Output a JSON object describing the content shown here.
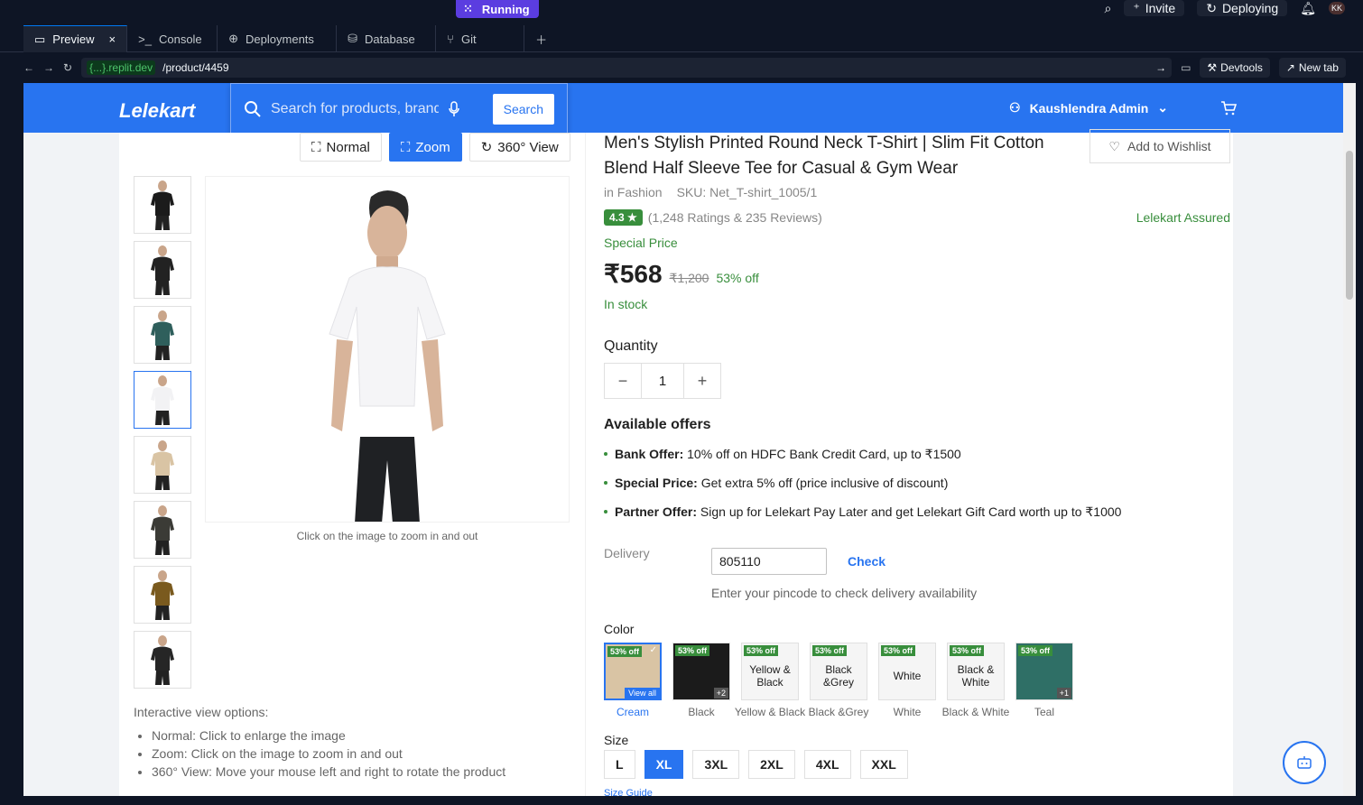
{
  "topbar": {
    "running": "Running",
    "invite": "Invite",
    "deploying": "Deploying",
    "avatar": "KK"
  },
  "tabs": [
    {
      "label": "Preview",
      "icon": "monitor-icon"
    },
    {
      "label": "Console",
      "icon": "terminal-icon"
    },
    {
      "label": "Deployments",
      "icon": "deploy-icon"
    },
    {
      "label": "Database",
      "icon": "database-icon"
    },
    {
      "label": "Git",
      "icon": "git-icon"
    }
  ],
  "browser": {
    "domain": "{...}.replit.dev",
    "path": "/product/4459",
    "devtools": "Devtools",
    "newtab": "New tab"
  },
  "header": {
    "logo": "Lelekart",
    "search_placeholder": "Search for products, brands",
    "search_button": "Search",
    "user": "Kaushlendra Admin"
  },
  "gallery": {
    "view_normal": "Normal",
    "view_zoom": "Zoom",
    "view_360": "360° View",
    "zoom_caption": "Click on the image to zoom in and out",
    "thumb_colors": [
      "#1b1b1b",
      "#222222",
      "#2f5f5c",
      "#f2f2f4",
      "#d9c4a4",
      "#3b3b36",
      "#7a5a1e",
      "#262626"
    ],
    "options_title": "Interactive view options:",
    "options": [
      "Normal: Click to enlarge the image",
      "Zoom: Click on the image to zoom in and out",
      "360° View: Move your mouse left and right to rotate the product"
    ]
  },
  "product": {
    "title": "Men's Stylish Printed Round Neck T-Shirt | Slim Fit Cotton Blend Half Sleeve Tee for Casual & Gym Wear",
    "wishlist": "Add to Wishlist",
    "category": "in Fashion",
    "sku": "SKU: Net_T-shirt_1005/1",
    "rating": "4.3 ★",
    "reviews": "(1,248 Ratings & 235 Reviews)",
    "assured": "Lelekart Assured",
    "special_price": "Special Price",
    "price": "₹568",
    "mrp": "₹1,200",
    "discount": "53% off",
    "stock": "In stock",
    "quantity_label": "Quantity",
    "quantity": "1",
    "offers_title": "Available offers",
    "offers": [
      {
        "title": "Bank Offer:",
        "text": "10% off on HDFC Bank Credit Card, up to ₹1500"
      },
      {
        "title": "Special Price:",
        "text": "Get extra 5% off (price inclusive of discount)"
      },
      {
        "title": "Partner Offer:",
        "text": "Sign up for Lelekart Pay Later and get Lelekart Gift Card worth up to ₹1000"
      }
    ],
    "delivery_label": "Delivery",
    "pincode": "805110",
    "check": "Check",
    "pin_hint": "Enter your pincode to check delivery availability",
    "color_label": "Color",
    "colors": [
      {
        "name": "Cream",
        "badge": "53% off",
        "thumb": "",
        "extra": "View all",
        "bg": "#d9c4a4"
      },
      {
        "name": "Black",
        "badge": "53% off",
        "thumb": "",
        "extra": "+2",
        "bg": "#1b1b1b"
      },
      {
        "name": "Yellow & Black",
        "badge": "53% off",
        "thumb": "Yellow & Black",
        "extra": "",
        "bg": ""
      },
      {
        "name": "Black &Grey",
        "badge": "53% off",
        "thumb": "Black &Grey",
        "extra": "",
        "bg": ""
      },
      {
        "name": "White",
        "badge": "53% off",
        "thumb": "White",
        "extra": "",
        "bg": ""
      },
      {
        "name": "Black & White",
        "badge": "53% off",
        "thumb": "Black & White",
        "extra": "",
        "bg": ""
      },
      {
        "name": "Teal",
        "badge": "53% off",
        "thumb": "",
        "extra": "+1",
        "bg": "#2f6f66"
      }
    ],
    "size_label": "Size",
    "sizes": [
      "L",
      "XL",
      "3XL",
      "2XL",
      "4XL",
      "XXL"
    ],
    "size_guide": "Size Guide"
  }
}
